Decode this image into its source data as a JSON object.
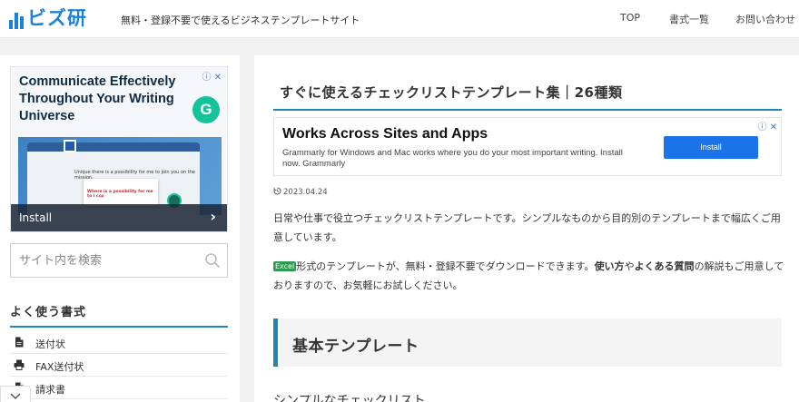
{
  "header": {
    "logo_text": "ビズ研",
    "tagline": "無料・登録不要で使えるビジネステンプレートサイト",
    "nav": {
      "top": "TOP",
      "formats": "書式一覧",
      "contact": "お問い合わせ"
    }
  },
  "sidebar": {
    "ad": {
      "title": "Communicate Effectively Throughout Your Writing Universe",
      "info_label": "ⓘ ✕",
      "brand_icon": "grammarly-g-icon",
      "brand_letter": "G",
      "screen_line": "Unique there is a possibility for me to join you on the mission.",
      "screen_card_line": "Where is a possibility for me to i ccp",
      "cta_label": "Install",
      "cta_arrow": "›"
    },
    "search": {
      "placeholder": "サイト内を検索",
      "icon": "search-icon"
    },
    "favorites": {
      "title": "よく使う書式",
      "accent_color": "#1e87b8",
      "items": [
        {
          "label": "送付状",
          "icon": "document-icon"
        },
        {
          "label": "FAX送付状",
          "icon": "printer-icon"
        },
        {
          "label": "請求書",
          "icon": "document-icon"
        }
      ]
    }
  },
  "main": {
    "article_title": "すぐに使えるチェックリストテンプレート集｜26種類",
    "ad": {
      "title": "Works Across Sites and Apps",
      "description": "Grammarly for Windows and Mac works where you do your most important writing. Install now. Grammarly",
      "button_label": "Install",
      "info_label": "ⓘ ✕",
      "button_color": "#1a73e8"
    },
    "date": "2023.04.24",
    "date_icon": "update-icon",
    "paragraph_1": "日常や仕事で役立つチェックリストテンプレートです。シンプルなものから目的別のテンプレートまで幅広くご用意しています。",
    "paragraph_2": {
      "badge": "Excel",
      "text_a": "形式のテンプレートが、無料・登録不要でダウンロードできます。",
      "bold_a": "使い方",
      "text_b": "や",
      "bold_b": "よくある質問",
      "text_c": "の解説もご用意しておりますので、お気軽にお試しください。"
    },
    "section_heading": "基本テンプレート",
    "next_text": "シンプルなチェックリスト"
  },
  "colors": {
    "brand": "#1a82d8",
    "accent": "#1e87b8",
    "excel": "#2e9b4f"
  }
}
